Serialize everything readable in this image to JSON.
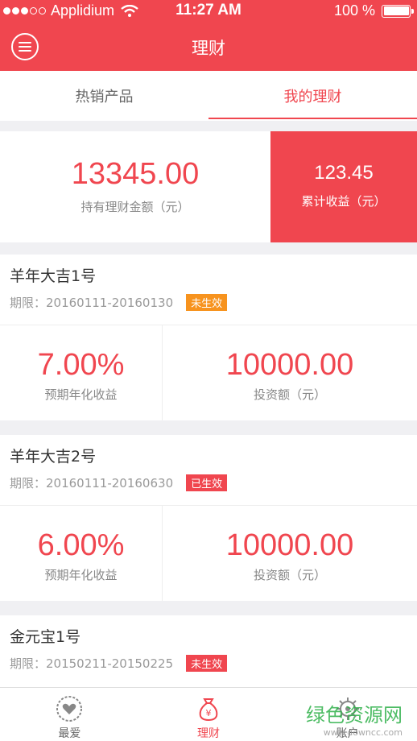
{
  "status": {
    "carrier": "Applidium",
    "time": "11:27 AM",
    "battery": "100 %"
  },
  "header": {
    "title": "理财"
  },
  "tabs": [
    {
      "label": "热销产品"
    },
    {
      "label": "我的理财"
    }
  ],
  "summary": {
    "holding": "13345.00",
    "holding_label": "持有理财金额（元）",
    "earnings": "123.45",
    "earnings_label": "累计收益（元）"
  },
  "products": [
    {
      "name": "羊年大吉1号",
      "period": "期限：20160111-20160130",
      "status": "未生效",
      "rate": "7.00%",
      "rate_label": "预期年化收益",
      "amount": "10000.00",
      "amount_label": "投资额（元）"
    },
    {
      "name": "羊年大吉2号",
      "period": "期限：20160111-20160630",
      "status": "已生效",
      "rate": "6.00%",
      "rate_label": "预期年化收益",
      "amount": "10000.00",
      "amount_label": "投资额（元）"
    },
    {
      "name": "金元宝1号",
      "period": "期限：20150211-20150225",
      "status": "未生效"
    }
  ],
  "bottom_nav": [
    {
      "label": "最爱"
    },
    {
      "label": "理财"
    },
    {
      "label": "账户"
    }
  ],
  "watermark": {
    "text": "绿色资源网",
    "url": "www.downcc.com"
  },
  "colors": {
    "accent": "#f0464f",
    "badge_orange": "#f7931e"
  }
}
